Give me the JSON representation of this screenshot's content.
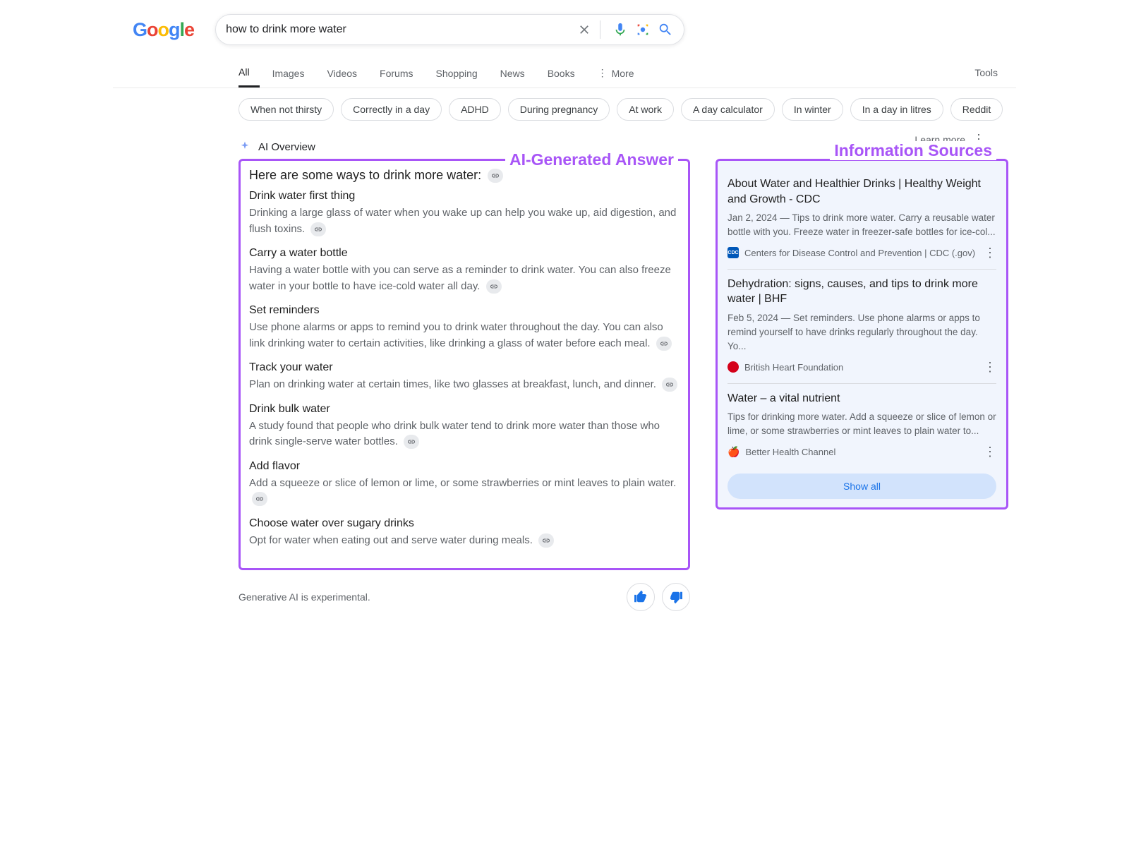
{
  "search": {
    "query": "how to drink more water"
  },
  "tabs": [
    "All",
    "Images",
    "Videos",
    "Forums",
    "Shopping",
    "News",
    "Books"
  ],
  "more_label": "More",
  "tools_label": "Tools",
  "chips": [
    "When not thirsty",
    "Correctly in a day",
    "ADHD",
    "During pregnancy",
    "At work",
    "A day calculator",
    "In winter",
    "In a day in litres",
    "Reddit"
  ],
  "ai_overview_label": "AI Overview",
  "learn_more_label": "Learn more",
  "annotations": {
    "answer": "AI-Generated Answer",
    "sources": "Information Sources"
  },
  "answer": {
    "intro": "Here are some ways to drink more water:",
    "sections": [
      {
        "title": "Drink water first thing",
        "body": "Drinking a large glass of water when you wake up can help you wake up, aid digestion, and flush toxins."
      },
      {
        "title": "Carry a water bottle",
        "body": "Having a water bottle with you can serve as a reminder to drink water. You can also freeze water in your bottle to have ice-cold water all day."
      },
      {
        "title": "Set reminders",
        "body": "Use phone alarms or apps to remind you to drink water throughout the day. You can also link drinking water to certain activities, like drinking a glass of water before each meal."
      },
      {
        "title": "Track your water",
        "body": "Plan on drinking water at certain times, like two glasses at breakfast, lunch, and dinner."
      },
      {
        "title": "Drink bulk water",
        "body": "A study found that people who drink bulk water tend to drink more water than those who drink single-serve water bottles."
      },
      {
        "title": "Add flavor",
        "body": "Add a squeeze or slice of lemon or lime, or some strawberries or mint leaves to plain water."
      },
      {
        "title": "Choose water over sugary drinks",
        "body": "Opt for water when eating out and serve water during meals."
      }
    ]
  },
  "sources": [
    {
      "title": "About Water and Healthier Drinks | Healthy Weight and Growth - CDC",
      "snippet": "Jan 2, 2024 — Tips to drink more water. Carry a reusable water bottle with you. Freeze water in freezer-safe bottles for ice-col...",
      "site": "Centers for Disease Control and Prevention | CDC (.gov)",
      "fav": "cdc"
    },
    {
      "title": "Dehydration: signs, causes, and tips to drink more water | BHF",
      "snippet": "Feb 5, 2024 — Set reminders. Use phone alarms or apps to remind yourself to have drinks regularly throughout the day. Yo...",
      "site": "British Heart Foundation",
      "fav": "bhf"
    },
    {
      "title": "Water – a vital nutrient",
      "snippet": "Tips for drinking more water. Add a squeeze or slice of lemon or lime, or some strawberries or mint leaves to plain water to...",
      "site": "Better Health Channel",
      "fav": "apple"
    }
  ],
  "show_all_label": "Show all",
  "experimental_label": "Generative AI is experimental."
}
